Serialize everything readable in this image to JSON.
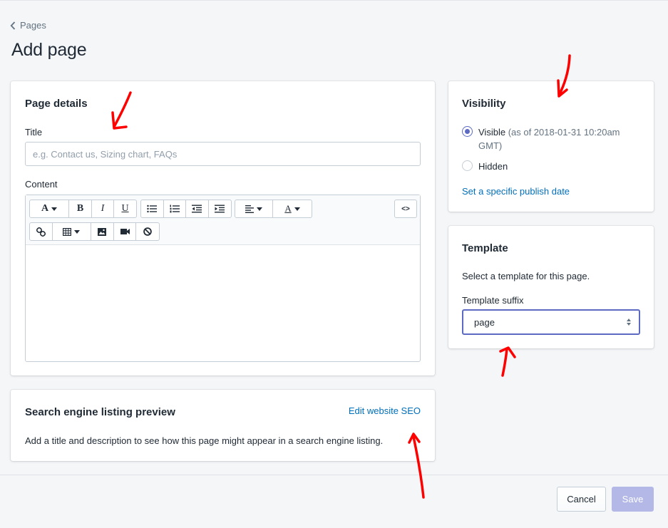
{
  "breadcrumb": {
    "label": "Pages"
  },
  "page_title": "Add page",
  "details": {
    "title": "Page details",
    "title_label": "Title",
    "title_placeholder": "e.g. Contact us, Sizing chart, FAQs",
    "content_label": "Content",
    "toolbar": {
      "font_glyph": "A",
      "bold": "B",
      "italic": "I",
      "underline": "U",
      "color_glyph": "A",
      "html_glyph": "<>"
    }
  },
  "visibility": {
    "title": "Visibility",
    "visible_label": "Visible",
    "visible_note": "(as of 2018-01-31 10:20am GMT)",
    "hidden_label": "Hidden",
    "publish_link": "Set a specific publish date"
  },
  "template": {
    "title": "Template",
    "description": "Select a template for this page.",
    "suffix_label": "Template suffix",
    "suffix_value": "page"
  },
  "seo": {
    "title": "Search engine listing preview",
    "edit_link": "Edit website SEO",
    "description": "Add a title and description to see how this page might appear in a search engine listing."
  },
  "footer": {
    "cancel": "Cancel",
    "save": "Save"
  },
  "colors": {
    "accent": "#5c6ac4",
    "link": "#006fbb",
    "annotation": "#ff0000",
    "save_disabled": "#b3b8e6"
  }
}
